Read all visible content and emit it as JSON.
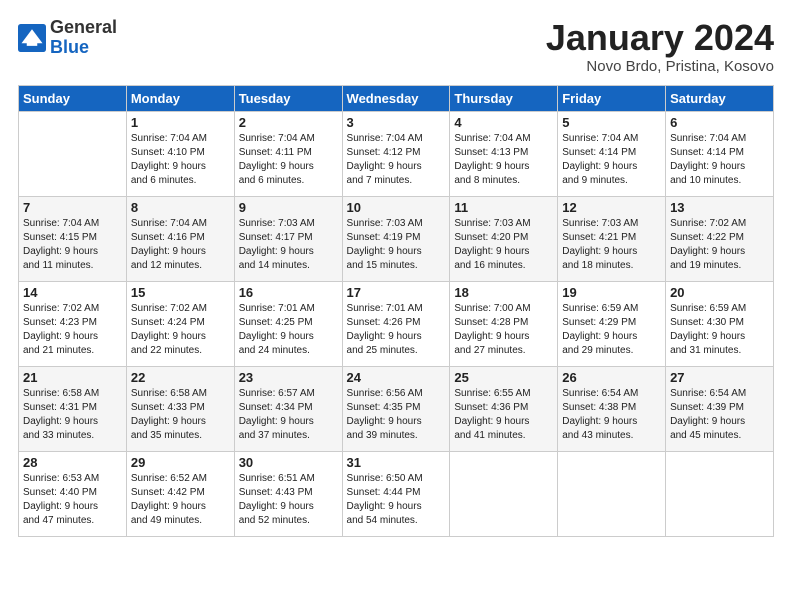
{
  "logo": {
    "general": "General",
    "blue": "Blue"
  },
  "title": "January 2024",
  "location": "Novo Brdo, Pristina, Kosovo",
  "days": [
    "Sunday",
    "Monday",
    "Tuesday",
    "Wednesday",
    "Thursday",
    "Friday",
    "Saturday"
  ],
  "weeks": [
    [
      {
        "day": "",
        "info": ""
      },
      {
        "day": "1",
        "info": "Sunrise: 7:04 AM\nSunset: 4:10 PM\nDaylight: 9 hours\nand 6 minutes."
      },
      {
        "day": "2",
        "info": "Sunrise: 7:04 AM\nSunset: 4:11 PM\nDaylight: 9 hours\nand 6 minutes."
      },
      {
        "day": "3",
        "info": "Sunrise: 7:04 AM\nSunset: 4:12 PM\nDaylight: 9 hours\nand 7 minutes."
      },
      {
        "day": "4",
        "info": "Sunrise: 7:04 AM\nSunset: 4:13 PM\nDaylight: 9 hours\nand 8 minutes."
      },
      {
        "day": "5",
        "info": "Sunrise: 7:04 AM\nSunset: 4:14 PM\nDaylight: 9 hours\nand 9 minutes."
      },
      {
        "day": "6",
        "info": "Sunrise: 7:04 AM\nSunset: 4:14 PM\nDaylight: 9 hours\nand 10 minutes."
      }
    ],
    [
      {
        "day": "7",
        "info": "Sunrise: 7:04 AM\nSunset: 4:15 PM\nDaylight: 9 hours\nand 11 minutes."
      },
      {
        "day": "8",
        "info": "Sunrise: 7:04 AM\nSunset: 4:16 PM\nDaylight: 9 hours\nand 12 minutes."
      },
      {
        "day": "9",
        "info": "Sunrise: 7:03 AM\nSunset: 4:17 PM\nDaylight: 9 hours\nand 14 minutes."
      },
      {
        "day": "10",
        "info": "Sunrise: 7:03 AM\nSunset: 4:19 PM\nDaylight: 9 hours\nand 15 minutes."
      },
      {
        "day": "11",
        "info": "Sunrise: 7:03 AM\nSunset: 4:20 PM\nDaylight: 9 hours\nand 16 minutes."
      },
      {
        "day": "12",
        "info": "Sunrise: 7:03 AM\nSunset: 4:21 PM\nDaylight: 9 hours\nand 18 minutes."
      },
      {
        "day": "13",
        "info": "Sunrise: 7:02 AM\nSunset: 4:22 PM\nDaylight: 9 hours\nand 19 minutes."
      }
    ],
    [
      {
        "day": "14",
        "info": "Sunrise: 7:02 AM\nSunset: 4:23 PM\nDaylight: 9 hours\nand 21 minutes."
      },
      {
        "day": "15",
        "info": "Sunrise: 7:02 AM\nSunset: 4:24 PM\nDaylight: 9 hours\nand 22 minutes."
      },
      {
        "day": "16",
        "info": "Sunrise: 7:01 AM\nSunset: 4:25 PM\nDaylight: 9 hours\nand 24 minutes."
      },
      {
        "day": "17",
        "info": "Sunrise: 7:01 AM\nSunset: 4:26 PM\nDaylight: 9 hours\nand 25 minutes."
      },
      {
        "day": "18",
        "info": "Sunrise: 7:00 AM\nSunset: 4:28 PM\nDaylight: 9 hours\nand 27 minutes."
      },
      {
        "day": "19",
        "info": "Sunrise: 6:59 AM\nSunset: 4:29 PM\nDaylight: 9 hours\nand 29 minutes."
      },
      {
        "day": "20",
        "info": "Sunrise: 6:59 AM\nSunset: 4:30 PM\nDaylight: 9 hours\nand 31 minutes."
      }
    ],
    [
      {
        "day": "21",
        "info": "Sunrise: 6:58 AM\nSunset: 4:31 PM\nDaylight: 9 hours\nand 33 minutes."
      },
      {
        "day": "22",
        "info": "Sunrise: 6:58 AM\nSunset: 4:33 PM\nDaylight: 9 hours\nand 35 minutes."
      },
      {
        "day": "23",
        "info": "Sunrise: 6:57 AM\nSunset: 4:34 PM\nDaylight: 9 hours\nand 37 minutes."
      },
      {
        "day": "24",
        "info": "Sunrise: 6:56 AM\nSunset: 4:35 PM\nDaylight: 9 hours\nand 39 minutes."
      },
      {
        "day": "25",
        "info": "Sunrise: 6:55 AM\nSunset: 4:36 PM\nDaylight: 9 hours\nand 41 minutes."
      },
      {
        "day": "26",
        "info": "Sunrise: 6:54 AM\nSunset: 4:38 PM\nDaylight: 9 hours\nand 43 minutes."
      },
      {
        "day": "27",
        "info": "Sunrise: 6:54 AM\nSunset: 4:39 PM\nDaylight: 9 hours\nand 45 minutes."
      }
    ],
    [
      {
        "day": "28",
        "info": "Sunrise: 6:53 AM\nSunset: 4:40 PM\nDaylight: 9 hours\nand 47 minutes."
      },
      {
        "day": "29",
        "info": "Sunrise: 6:52 AM\nSunset: 4:42 PM\nDaylight: 9 hours\nand 49 minutes."
      },
      {
        "day": "30",
        "info": "Sunrise: 6:51 AM\nSunset: 4:43 PM\nDaylight: 9 hours\nand 52 minutes."
      },
      {
        "day": "31",
        "info": "Sunrise: 6:50 AM\nSunset: 4:44 PM\nDaylight: 9 hours\nand 54 minutes."
      },
      {
        "day": "",
        "info": ""
      },
      {
        "day": "",
        "info": ""
      },
      {
        "day": "",
        "info": ""
      }
    ]
  ],
  "row_shades": [
    "white",
    "shade",
    "white",
    "shade",
    "white"
  ]
}
